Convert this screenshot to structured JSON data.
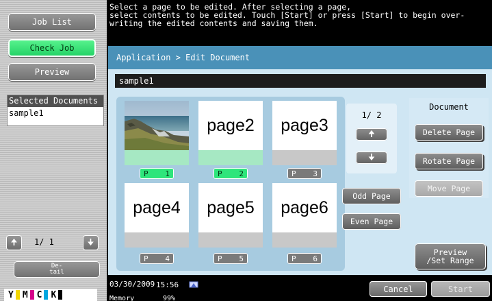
{
  "left_panel": {
    "job_list": "Job List",
    "check_job": "Check Job",
    "preview": "Preview",
    "selected_documents_title": "Selected Documents",
    "selected_documents": [
      "sample1"
    ],
    "page_indicator": "1/  1",
    "up_arrow": "🠉",
    "down_arrow": "🠋",
    "detail_line1": "De-",
    "detail_line2": "tail",
    "toner": [
      {
        "label": "Y",
        "color": "#f2d600"
      },
      {
        "label": "M",
        "color": "#d6008a"
      },
      {
        "label": "C",
        "color": "#00a7e0"
      },
      {
        "label": "K",
        "color": "#000000"
      }
    ]
  },
  "message": "Select a page to be edited. After selecting a page,\nselect contents to be edited. Touch [Start] or press [Start] to begin over-\nwriting the edited contents and saving them.",
  "breadcrumb": "Application > Edit Document",
  "document_name": "sample1",
  "pages": [
    {
      "text": "",
      "label": "P",
      "num": "1",
      "selected": true,
      "image": "coastline-photo"
    },
    {
      "text": "page2",
      "label": "P",
      "num": "2",
      "selected": true
    },
    {
      "text": "page3",
      "label": "P",
      "num": "3",
      "selected": false
    },
    {
      "text": "page4",
      "label": "P",
      "num": "4",
      "selected": false
    },
    {
      "text": "page5",
      "label": "P",
      "num": "5",
      "selected": false
    },
    {
      "text": "page6",
      "label": "P",
      "num": "6",
      "selected": false
    }
  ],
  "page_nav": {
    "indicator": "1/  2",
    "up": "🠉",
    "down": "🠋"
  },
  "odd_page": "Odd Page",
  "even_page": "Even Page",
  "document_panel": {
    "title": "Document",
    "delete_page": "Delete Page",
    "rotate_page": "Rotate Page",
    "move_page": "Move Page"
  },
  "preview_set_range": "Preview\n/Set Range",
  "status": {
    "date": "03/30/2009",
    "time": "15:56",
    "memory_label": "Memory",
    "memory_value": "99%"
  },
  "cancel": "Cancel",
  "start": "Start"
}
